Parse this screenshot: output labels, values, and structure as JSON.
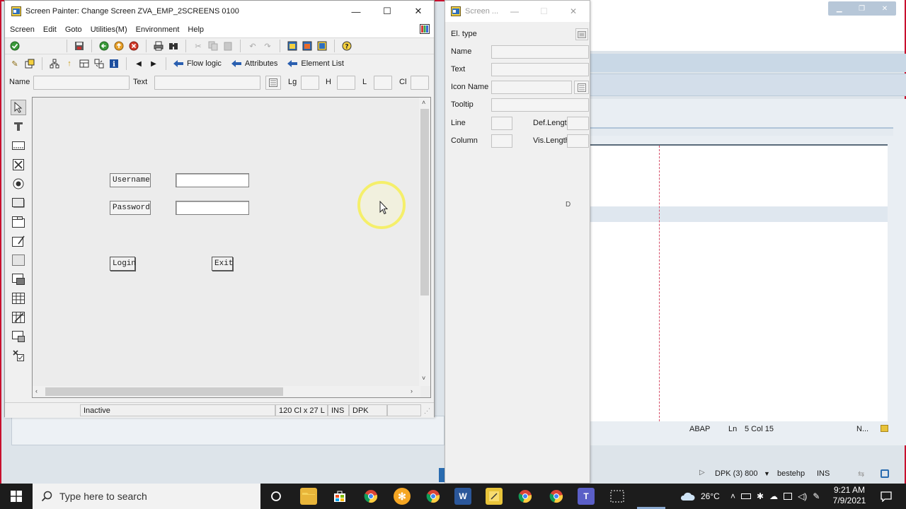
{
  "screen_painter": {
    "title": "Screen Painter:  Change Screen ZVA_EMP_2SCREENS 0100",
    "menu": [
      "Screen",
      "Edit",
      "Goto",
      "Utilities(M)",
      "Environment",
      "Help"
    ],
    "nav_buttons": {
      "flow_logic": "Flow logic",
      "attributes": "Attributes",
      "element_list": "Element List"
    },
    "field_labels": {
      "name": "Name",
      "text": "Text",
      "lg": "Lg",
      "h": "H",
      "l": "L",
      "cl": "Cl"
    },
    "form": {
      "username_label": "Username",
      "password_label": "Password",
      "login_button": "Login",
      "exit_button": "Exit"
    },
    "status": {
      "state": "Inactive",
      "size": "120 Cl x 27 L",
      "mode": "INS",
      "system": "DPK"
    }
  },
  "attributes_window": {
    "title": "Screen ...",
    "labels": {
      "el_type": "El. type",
      "name": "Name",
      "text": "Text",
      "icon_name": "Icon Name",
      "tooltip": "Tooltip",
      "line": "Line",
      "def_length": "Def.Lengt",
      "column": "Column",
      "vis_length": "Vis.Length"
    },
    "marker": "D"
  },
  "editor_status": {
    "language": "ABAP",
    "line_label": "Ln",
    "position": "5 Col  15",
    "more": "N..."
  },
  "session_status": {
    "system": "DPK (3) 800",
    "user": "bestehp",
    "mode": "INS"
  },
  "taskbar": {
    "search_placeholder": "Type here to search",
    "temperature": "26°C",
    "time": "9:21 AM",
    "date": "7/9/2021"
  }
}
